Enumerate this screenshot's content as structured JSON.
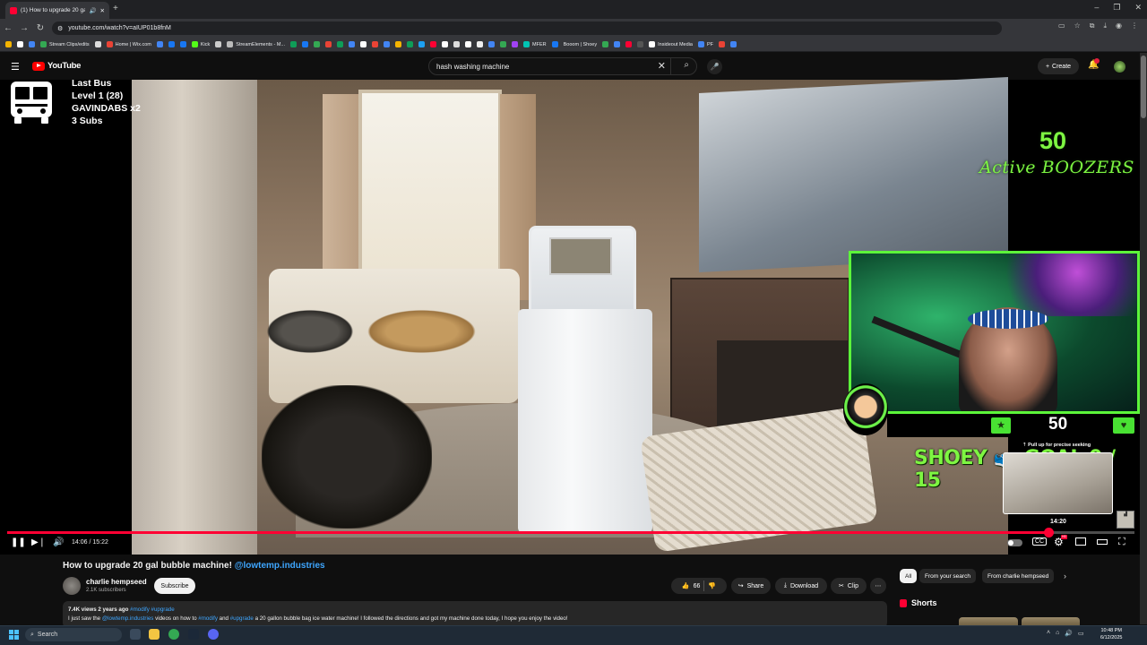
{
  "browser": {
    "tab_title": "(1) How to upgrade 20 gal",
    "url": "youtube.com/watch?v=aIUP01b8fnM",
    "bookmarks": [
      "Stream Clips/edits",
      "Home | Wix.com",
      "Kick",
      "StreamElements - M...",
      "MFER",
      "Booom | Shoey",
      "Insideout Media",
      "PF"
    ]
  },
  "youtube": {
    "logo": "YouTube",
    "search_value": "hash washing machine",
    "create_label": "Create"
  },
  "overlay": {
    "bus_line1": "Last Bus",
    "bus_line2": "Level 1  (28)",
    "bus_line3": "GAVINDABS x2",
    "bus_line4": "3 Subs",
    "boozer_count": "50",
    "boozer_label": "Active BOOZERS",
    "hud_count": "50",
    "shoey_goal": "SHOEY 👟 GOAL  0 / 15"
  },
  "player": {
    "time": "14:06 / 15:22",
    "progress_fraction": 0.924,
    "seek_hint": "Pull up for precise seeking",
    "preview_time": "14:20",
    "cc_label": "CC",
    "hd_label": "HD"
  },
  "video": {
    "title": "How to upgrade 20 gal bubble machine!",
    "title_tag": "@lowtemp.industries",
    "channel": "charlie hempseed",
    "subscribers": "2.1K subscribers",
    "subscribe_label": "Subscribe",
    "likes": "66",
    "share_label": "Share",
    "download_label": "Download",
    "clip_label": "Clip",
    "views_date": "7.4K views  2 years ago",
    "desc_tags": "#modify #upgrade",
    "desc_part1": "I just saw the ",
    "desc_mention": "@lowtemp.industries",
    "desc_part2": " videos on how to ",
    "desc_tag1": "#modify",
    "desc_part3": " and ",
    "desc_tag2": "#upgrade",
    "desc_part4": " a 20 gallon bubble bag ice water machine! I followed the directions and got my machine done today, I hope you enjoy the video!"
  },
  "sidebar": {
    "chips": [
      "All",
      "From your search",
      "From charlie hempseed"
    ],
    "shorts_label": "Shorts"
  },
  "taskbar": {
    "search_placeholder": "Search",
    "time": "10:48 PM",
    "date": "6/12/2025"
  },
  "colors": {
    "yt_red": "#ff0033",
    "overlay_green": "#7ef542",
    "link_blue": "#3ea6ff"
  }
}
